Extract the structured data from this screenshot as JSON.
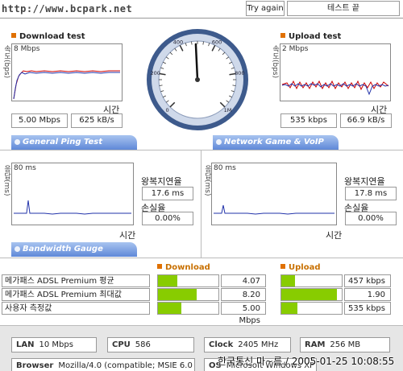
{
  "header": {
    "url": "http://www.bcpark.net",
    "try_again_label": "Try again",
    "end_test_label": "테스트 끝"
  },
  "colors": {
    "accent": "#e07000",
    "tab_blue": "#5f88d8",
    "bar_green": "#88cc00"
  },
  "download": {
    "title": "Download test",
    "y_axis_label": "속도(bps)",
    "max_label": "8 Mbps",
    "x_axis_label": "시간",
    "speed_mbps": "5.00 Mbps",
    "speed_kBs": "625 kB/s"
  },
  "upload": {
    "title": "Upload test",
    "y_axis_label": "속도(bps)",
    "max_label": "2 Mbps",
    "x_axis_label": "시간",
    "speed_kbps": "535 kbps",
    "speed_kBs": "66.9 kB/s"
  },
  "gauge": {
    "ticks": [
      "0",
      "200",
      "400",
      "600",
      "800",
      "1M"
    ],
    "needle_fraction": 0.49
  },
  "ping": {
    "tab_label": "General Ping Test",
    "y_axis_label": "응답(ms)",
    "max_label": "80 ms",
    "x_axis_label": "시간",
    "rtt_label": "왕복지연율",
    "rtt_value": "17.6 ms",
    "loss_label": "손실율",
    "loss_value": "0.00%"
  },
  "game": {
    "tab_label": "Network Game & VoIP Test",
    "y_axis_label": "응답(ms)",
    "max_label": "80 ms",
    "x_axis_label": "시간",
    "rtt_label": "왕복지연율",
    "rtt_value": "17.8 ms",
    "loss_label": "손실율",
    "loss_value": "0.00%"
  },
  "bandwidth": {
    "tab_label": "Bandwidth Gauge",
    "download_header": "Download",
    "upload_header": "Upload",
    "rows": [
      {
        "label": "메가패스 ADSL Premium 평균",
        "down": "4.07 Mbps",
        "down_fraction": 0.32,
        "up": "457 kbps",
        "up_fraction": 0.22
      },
      {
        "label": "메가패스 ADSL Premium 최대값",
        "down": "8.20 Mbps",
        "down_fraction": 0.64,
        "up": "1.90 Mbps",
        "up_fraction": 0.92
      },
      {
        "label": "사용자 측정값",
        "down": "5.00 Mbps",
        "down_fraction": 0.39,
        "up": "535 kbps",
        "up_fraction": 0.26
      }
    ]
  },
  "system": {
    "lan_label": "LAN",
    "lan_value": "10 Mbps",
    "cpu_label": "CPU",
    "cpu_value": "586",
    "clock_label": "Clock",
    "clock_value": "2405 MHz",
    "ram_label": "RAM",
    "ram_value": "256 MB",
    "browser_label": "Browser",
    "browser_value": "Mozilla/4.0 (compatible; MSIE 6.0",
    "os_label": "OS",
    "os_value": "Microsoft Windows XP",
    "watermark": "한국통신 마~름 / 2005-01-25 10:08:55"
  }
}
